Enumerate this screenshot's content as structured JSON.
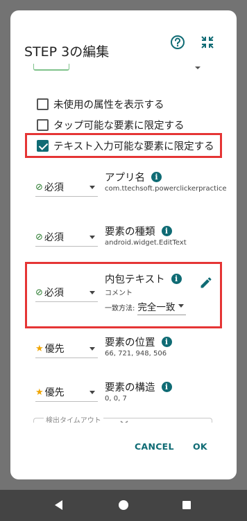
{
  "dialog": {
    "title": "STEP 3の編集",
    "icons": {
      "help": "help-circle-icon",
      "collapse": "collapse-icon"
    }
  },
  "checkboxes": [
    {
      "label": "未使用の属性を表示する",
      "checked": false
    },
    {
      "label": "タップ可能な要素に限定する",
      "checked": false
    },
    {
      "label": "テキスト入力可能な要素に限定する",
      "checked": true
    }
  ],
  "properties": [
    {
      "condition": "必須",
      "condition_icon": "check-circle-icon",
      "title": "アプリ名",
      "value": "com.ttechsoft.powerclickerpractice"
    },
    {
      "condition": "必須",
      "condition_icon": "check-circle-icon",
      "title": "要素の種類",
      "value": "android.widget.EditText"
    },
    {
      "condition": "必須",
      "condition_icon": "check-circle-icon",
      "title": "内包テキスト",
      "value": "コメント",
      "match_label": "一致方法:",
      "match_value": "完全一致"
    },
    {
      "condition": "優先",
      "condition_icon": "star-icon",
      "title": "要素の位置",
      "value": "66, 721, 948, 506"
    },
    {
      "condition": "優先",
      "condition_icon": "star-icon",
      "title": "要素の構造",
      "value": "0, 0, 7"
    }
  ],
  "timeout": {
    "label": "検出タイムアウト"
  },
  "actions": {
    "cancel": "CANCEL",
    "ok": "OK"
  },
  "colors": {
    "accent": "#0f6b74",
    "highlight": "#e53535",
    "required": "#2e7d32",
    "star": "#f0a500"
  }
}
